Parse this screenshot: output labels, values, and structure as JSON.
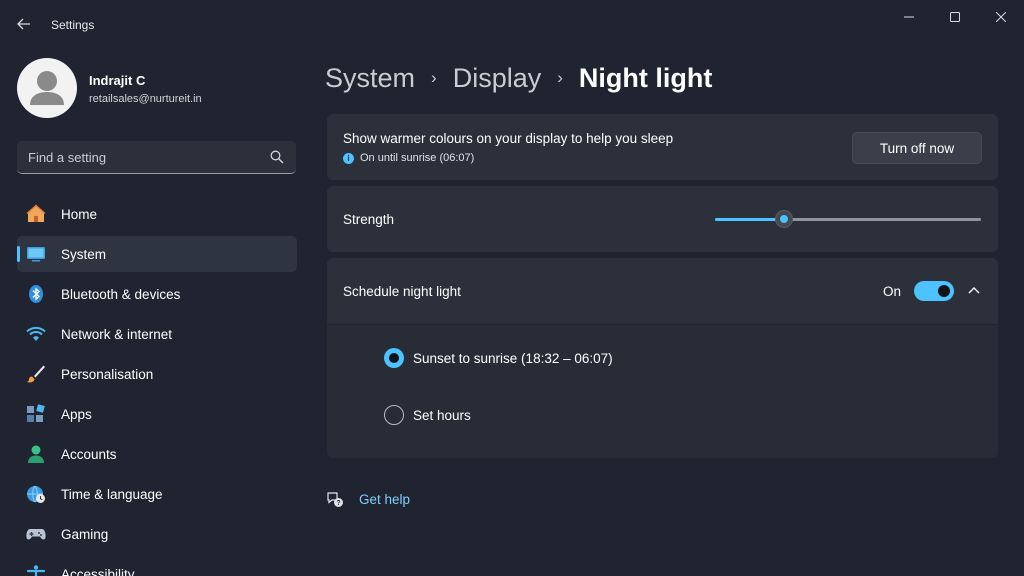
{
  "app": {
    "title": "Settings"
  },
  "user": {
    "name": "Indrajit C",
    "email": "retailsales@nurtureit.in"
  },
  "search": {
    "placeholder": "Find a setting"
  },
  "sidebar": {
    "items": [
      {
        "label": "Home",
        "icon": "home-icon"
      },
      {
        "label": "System",
        "icon": "system-icon",
        "active": true
      },
      {
        "label": "Bluetooth & devices",
        "icon": "bluetooth-icon"
      },
      {
        "label": "Network & internet",
        "icon": "wifi-icon"
      },
      {
        "label": "Personalisation",
        "icon": "brush-icon"
      },
      {
        "label": "Apps",
        "icon": "apps-icon"
      },
      {
        "label": "Accounts",
        "icon": "accounts-icon"
      },
      {
        "label": "Time & language",
        "icon": "globe-clock-icon"
      },
      {
        "label": "Gaming",
        "icon": "gamepad-icon"
      },
      {
        "label": "Accessibility",
        "icon": "accessibility-icon"
      }
    ]
  },
  "breadcrumb": {
    "items": [
      "System",
      "Display",
      "Night light"
    ],
    "separator": "›"
  },
  "night_light": {
    "description": "Show warmer colours on your display to help you sleep",
    "status": "On until sunrise (06:07)",
    "button_label": "Turn off now",
    "strength_label": "Strength",
    "strength_value": 0.26,
    "schedule_label": "Schedule night light",
    "schedule_state": "On",
    "schedule_on": true,
    "options": [
      {
        "label": "Sunset to sunrise (18:32 – 06:07)",
        "selected": true
      },
      {
        "label": "Set hours",
        "selected": false
      }
    ]
  },
  "help": {
    "label": "Get help"
  },
  "colors": {
    "accent": "#4cc2ff",
    "background": "#1f2430",
    "card": "#2b303b"
  }
}
